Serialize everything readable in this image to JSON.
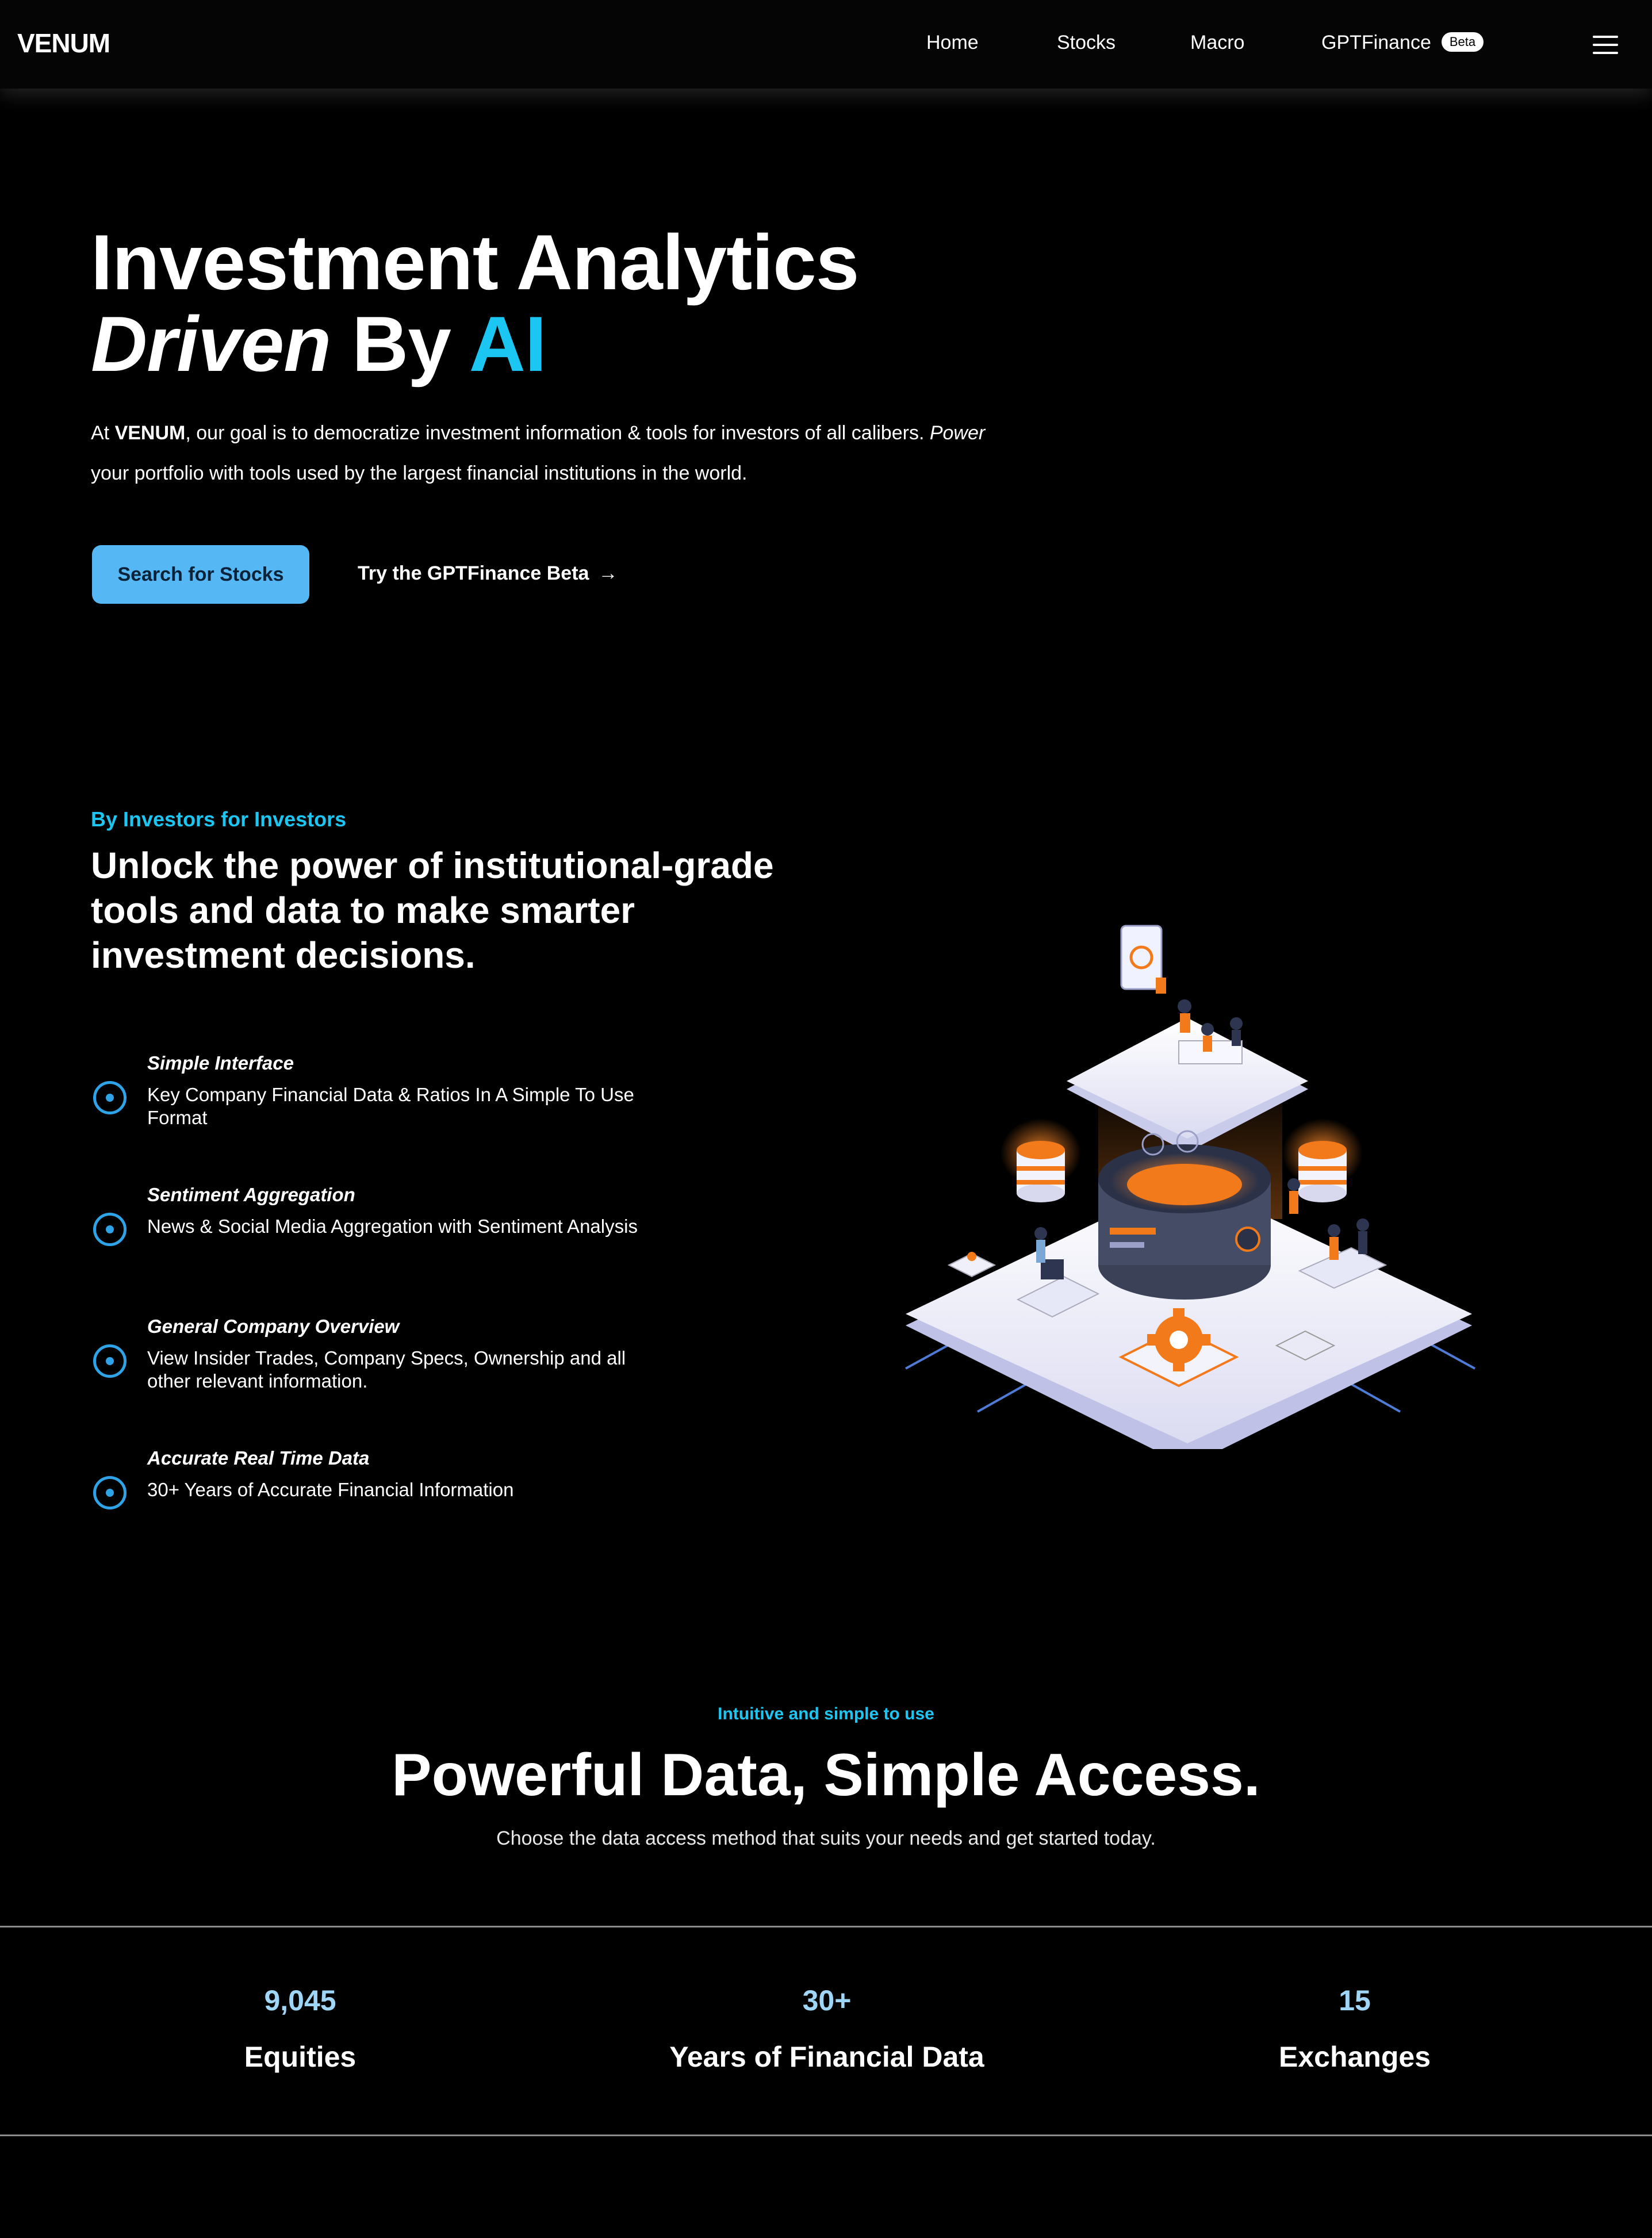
{
  "nav": {
    "logo": "VENUM",
    "links": [
      "Home",
      "Stocks",
      "Macro",
      "GPTFinance"
    ],
    "beta_badge": "Beta"
  },
  "hero": {
    "title_line1": "Investment Analytics",
    "title_italic": "Driven",
    "title_by": "By",
    "title_accent": "AI",
    "desc_prefix": "At",
    "desc_brand": "VENUM",
    "desc_body": ", our goal is to democratize investment information & tools for investors of all calibers.",
    "desc_italic": "Power",
    "desc_line2": "your portfolio with tools used by the largest financial institutions in the world.",
    "primary_button": "Search for Stocks",
    "secondary_link": "Try the GPTFinance Beta",
    "secondary_arrow": "→"
  },
  "features": {
    "eyebrow": "By Investors for Investors",
    "title": "Unlock the power of institutional-grade tools and data to make smarter investment decisions.",
    "items": [
      {
        "name": "Simple Interface",
        "desc": "Key Company Financial Data & Ratios In A Simple To Use Format"
      },
      {
        "name": "Sentiment Aggregation",
        "desc": "News & Social Media Aggregation with Sentiment Analysis"
      },
      {
        "name": "General Company Overview",
        "desc": "View Insider Trades, Company Specs, Ownership and all other relevant information."
      },
      {
        "name": "Accurate Real Time Data",
        "desc": "30+ Years of Accurate Financial Information"
      }
    ]
  },
  "access": {
    "eyebrow": "Intuitive and simple to use",
    "title": "Powerful Data, Simple Access.",
    "subtitle": "Choose the data access method that suits your needs and get started today."
  },
  "stats": [
    {
      "value": "9,045",
      "label": "Equities"
    },
    {
      "value": "30+",
      "label": "Years of Financial Data"
    },
    {
      "value": "15",
      "label": "Exchanges"
    }
  ],
  "colors": {
    "accent": "#1bc6f2",
    "button": "#55b7f3",
    "stat_number": "#9fd6f7",
    "illustration_orange": "#f27a1a"
  }
}
